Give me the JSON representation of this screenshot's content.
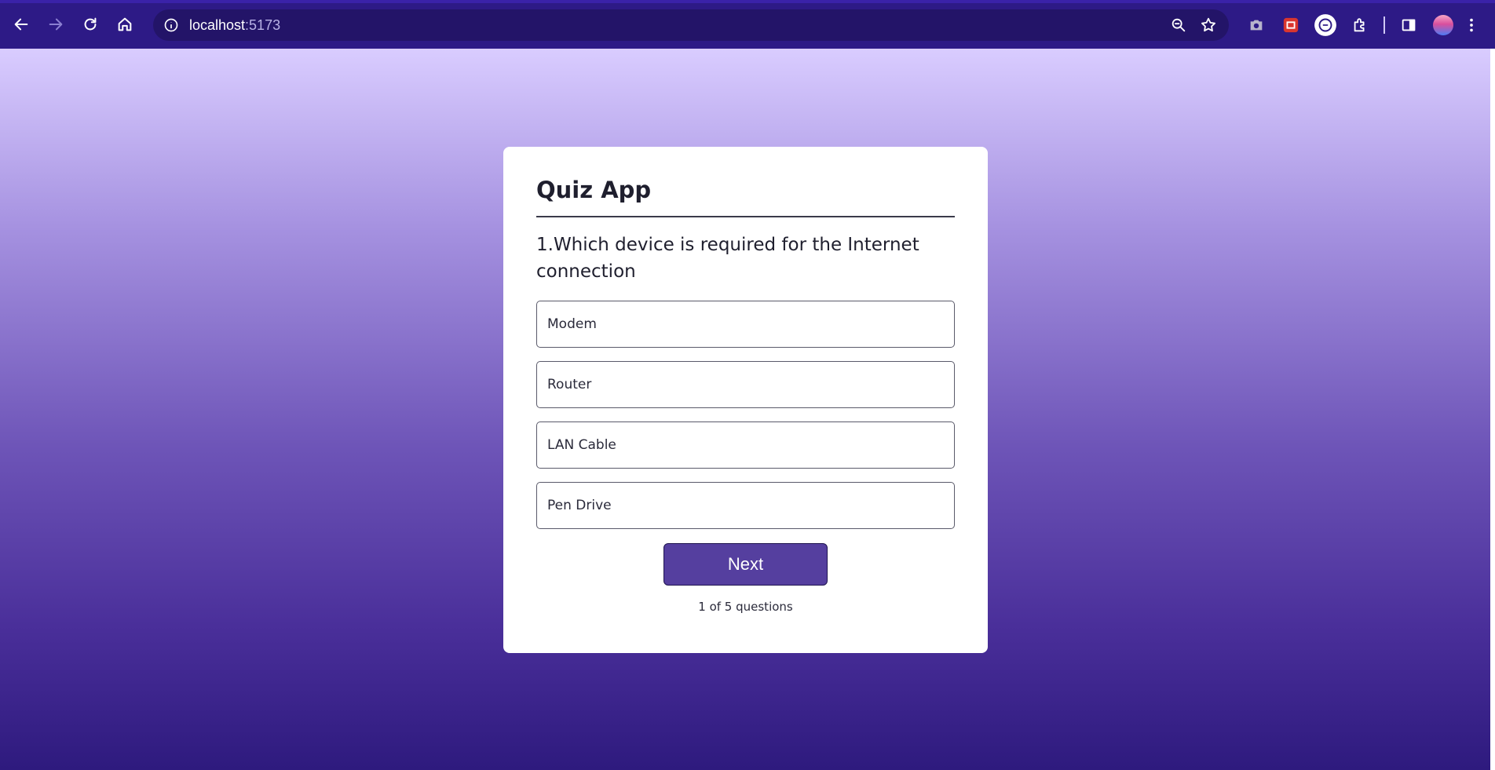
{
  "browser": {
    "url_host": "localhost",
    "url_port": ":5173"
  },
  "quiz": {
    "title": "Quiz App",
    "question": "1.Which device is required for the Internet connection",
    "options": [
      "Modem",
      "Router",
      "LAN Cable",
      "Pen Drive"
    ],
    "next_label": "Next",
    "progress": "1 of 5 questions"
  },
  "colors": {
    "accent": "#553f9f",
    "chrome": "#2d1a86",
    "card": "#ffffff"
  }
}
